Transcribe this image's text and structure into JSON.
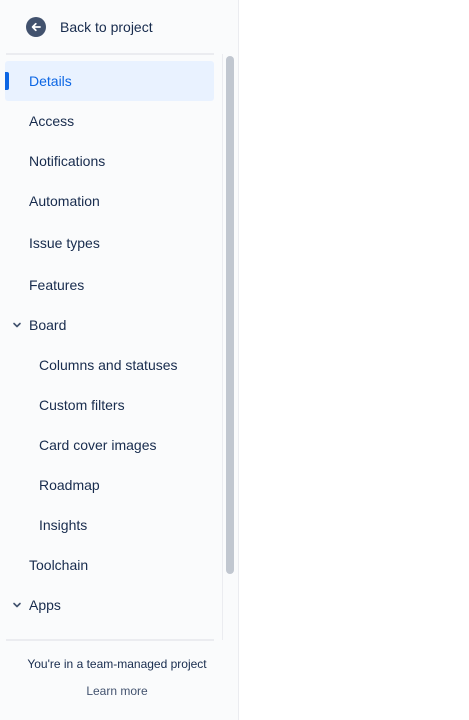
{
  "sidebar": {
    "back_label": "Back to project",
    "items": [
      {
        "label": "Details",
        "level": 1,
        "active": true
      },
      {
        "label": "Access",
        "level": 1
      },
      {
        "label": "Notifications",
        "level": 1
      },
      {
        "label": "Automation",
        "level": 1
      },
      {
        "label": "Issue types",
        "level": 1
      },
      {
        "label": "Features",
        "level": 1
      },
      {
        "label": "Board",
        "level": 1,
        "expandable": true,
        "expanded": true
      },
      {
        "label": "Columns and statuses",
        "level": 2
      },
      {
        "label": "Custom filters",
        "level": 2
      },
      {
        "label": "Card cover images",
        "level": 2
      },
      {
        "label": "Roadmap",
        "level": 2
      },
      {
        "label": "Insights",
        "level": 2
      },
      {
        "label": "Toolchain",
        "level": 1
      },
      {
        "label": "Apps",
        "level": 1,
        "expandable": true,
        "expanded": true
      }
    ],
    "footer_text": "You're in a team-managed project",
    "footer_link": "Learn more"
  },
  "colors": {
    "accent": "#0c66e4",
    "active_bg": "#e9f2ff",
    "text": "#172b4d",
    "sidebar_bg": "#fafbfc"
  },
  "icons": {
    "back": "arrow-left-circle-icon",
    "expand": "chevron-down-icon"
  }
}
